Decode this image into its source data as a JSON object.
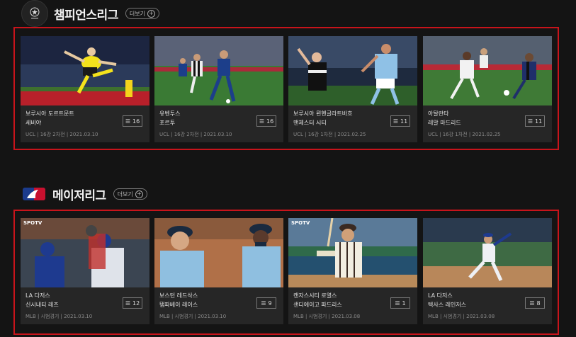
{
  "sections": [
    {
      "title": "챔피언스리그",
      "more_label": "더보기",
      "logo_icon": "ucl-starball-icon",
      "cards": [
        {
          "title1": "보루시아 도르트문트",
          "title2": "세비야",
          "meta": "UCL | 16강 2차전 | 2021.03.10",
          "count": "16"
        },
        {
          "title1": "유벤투스",
          "title2": "포르투",
          "meta": "UCL | 16강 2차전 | 2021.03.10",
          "count": "16"
        },
        {
          "title1": "보루시아 묀헨글라트바흐",
          "title2": "맨체스터 시티",
          "meta": "UCL | 16강 1차전 | 2021.02.25",
          "count": "11"
        },
        {
          "title1": "아탈란타",
          "title2": "레알 마드리드",
          "meta": "UCL | 16강 1차전 | 2021.02.25",
          "count": "11"
        }
      ]
    },
    {
      "title": "메이저리그",
      "more_label": "더보기",
      "logo_icon": "mlb-logo-icon",
      "cards": [
        {
          "title1": "LA 다저스",
          "title2": "신시내티 레즈",
          "meta": "MLB | 시범경기 | 2021.03.10",
          "count": "12"
        },
        {
          "title1": "보스턴 레드삭스",
          "title2": "탬파베이 레이스",
          "meta": "MLB | 시범경기 | 2021.03.10",
          "count": "9"
        },
        {
          "title1": "캔자스시티 로열스",
          "title2": "샌디에이고 파드리스",
          "meta": "MLB | 시범경기 | 2021.03.08",
          "count": "1"
        },
        {
          "title1": "LA 다저스",
          "title2": "텍사스 레인저스",
          "meta": "MLB | 시범경기 | 2021.03.08",
          "count": "8"
        }
      ]
    }
  ],
  "watermark": "SPOTV",
  "list_icon": "list-icon",
  "colors": {
    "highlight_border": "#c8141b",
    "background": "#141414",
    "card": "#262626"
  }
}
